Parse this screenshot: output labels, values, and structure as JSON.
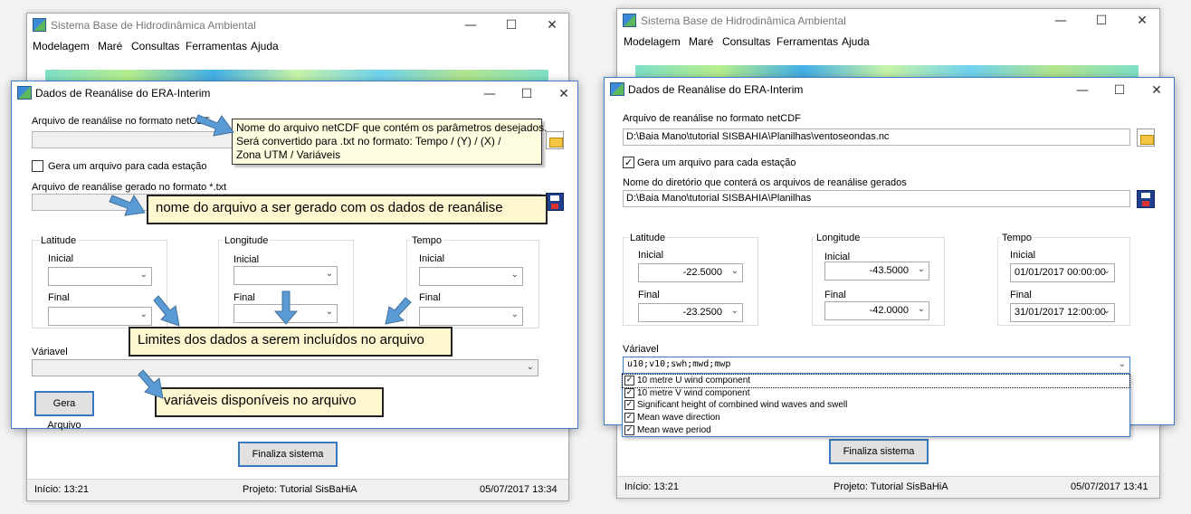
{
  "left": {
    "app": {
      "title": "Sistema Base de Hidrodinâmica Ambiental",
      "menu": [
        "Modelagem",
        "Maré",
        "Consultas",
        "Ferramentas",
        "Ajuda"
      ],
      "finish_label": "Finaliza sistema",
      "status": {
        "inicio": "Início: 13:21",
        "projeto": "Projeto: Tutorial SisBaHiA",
        "datetime": "05/07/2017 13:34"
      }
    },
    "dialog": {
      "title": "Dados de Reanálise do ERA-Interim",
      "netcdf_label": "Arquivo de reanálise no formato netCDF",
      "netcdf_value": "",
      "one_file_label": "Gera um arquivo para cada estação",
      "one_file_checked": false,
      "txt_label": "Arquivo de reanálise gerado no formato *.txt",
      "latitude_label": "Latitude",
      "longitude_label": "Longitude",
      "tempo_label": "Tempo",
      "inicial_label": "Inicial",
      "final_label": "Final",
      "variavel_label": "Váriavel",
      "gera_label": "Gera Arquivo"
    },
    "tooltip": [
      "Nome do arquivo netCDF que contém os parâmetros desejados.",
      "Será convertido para .txt no formato: Tempo / (Y) / (X) /",
      "Zona UTM / Variáveis"
    ],
    "callouts": {
      "output_name": "nome do arquivo a ser gerado com os dados de reanálise",
      "limits": "Limites dos dados a serem incluídos no arquivo",
      "variables": "variáveis disponíveis no arquivo"
    },
    "accent": "#fff7d0"
  },
  "right": {
    "app": {
      "title": "Sistema Base de Hidrodinâmica Ambiental",
      "menu": [
        "Modelagem",
        "Maré",
        "Consultas",
        "Ferramentas",
        "Ajuda"
      ],
      "finish_label": "Finaliza sistema",
      "status": {
        "inicio": "Início: 13:21",
        "projeto": "Projeto: Tutorial SisBaHiA",
        "datetime": "05/07/2017 13:41"
      }
    },
    "dialog": {
      "title": "Dados de Reanálise do ERA-Interim",
      "netcdf_label": "Arquivo de reanálise no formato netCDF",
      "netcdf_value": "D:\\Baia Mano\\tutorial SISBAHIA\\Planilhas\\ventoseondas.nc",
      "one_file_label": "Gera um arquivo para cada estação",
      "one_file_checked": true,
      "dir_label": "Nome do diretório que conterá os arquivos de reanálise gerados",
      "dir_value": "D:\\Baia Mano\\tutorial SISBAHIA\\Planilhas",
      "latitude_label": "Latitude",
      "longitude_label": "Longitude",
      "tempo_label": "Tempo",
      "inicial_label": "Inicial",
      "final_label": "Final",
      "lat_inicial": "-22.5000",
      "lat_final": "-23.2500",
      "lon_inicial": "-43.5000",
      "lon_final": "-42.0000",
      "tempo_inicial": "01/01/2017 00:00:00",
      "tempo_final": "31/01/2017 12:00:00",
      "variavel_label": "Váriavel",
      "variavel_value": "u10;v10;swh;mwd;mwp",
      "variable_options": [
        {
          "label": "10 metre U wind component",
          "checked": true
        },
        {
          "label": "10 metre V wind component",
          "checked": true
        },
        {
          "label": "Significant height of combined wind waves and swell",
          "checked": true
        },
        {
          "label": "Mean wave direction",
          "checked": true
        },
        {
          "label": "Mean wave period",
          "checked": true
        }
      ]
    }
  },
  "icons": {
    "app": "app-icon",
    "minimize": "minimize-icon",
    "maximize": "maximize-icon",
    "close": "close-icon",
    "folder": "folder-open-icon",
    "save": "floppy-save-icon",
    "dropdown": "chevron-down-icon",
    "arrow": "arrow-icon"
  },
  "glyphs": {
    "minimize": "—",
    "maximize": "☐",
    "close": "✕",
    "chevron": "⌄",
    "check": "✓"
  }
}
